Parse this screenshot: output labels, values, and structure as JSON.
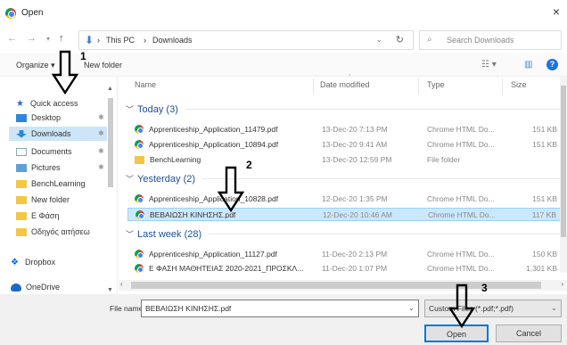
{
  "window": {
    "title": "Open",
    "close_glyph": "×",
    "icon": "chrome-icon"
  },
  "nav": {
    "back": "←",
    "forward": "→",
    "recent": "▾",
    "up": "↑",
    "breadcrumb": [
      "This PC",
      "Downloads"
    ],
    "separator": "›",
    "refresh_glyph": "↻",
    "dropdown_glyph": "⌄",
    "search_placeholder": "Search Downloads"
  },
  "toolbar": {
    "organize": "Organize",
    "new_folder": "New folder",
    "view_glyph": "☷ ▾",
    "pane_glyph": "▥",
    "help_glyph": "?"
  },
  "sidebar": {
    "items": [
      {
        "label": "Quick access",
        "icon": "star-icon",
        "pinned": false
      },
      {
        "label": "Desktop",
        "icon": "desktop-icon",
        "pinned": true
      },
      {
        "label": "Downloads",
        "icon": "downloads-icon",
        "pinned": true,
        "selected": true
      },
      {
        "label": "Documents",
        "icon": "documents-icon",
        "pinned": true
      },
      {
        "label": "Pictures",
        "icon": "pictures-icon",
        "pinned": true
      },
      {
        "label": "BenchLearning",
        "icon": "folder-icon",
        "pinned": false
      },
      {
        "label": "New folder",
        "icon": "folder-icon",
        "pinned": false
      },
      {
        "label": "Ε Φάση",
        "icon": "folder-icon",
        "pinned": false
      },
      {
        "label": "Οδηγός αιτήσεω",
        "icon": "folder-icon",
        "pinned": false
      },
      {
        "label": "Dropbox",
        "icon": "dropbox-icon",
        "pinned": false
      },
      {
        "label": "OneDrive",
        "icon": "onedrive-icon",
        "pinned": false
      }
    ],
    "pin_glyph": "✱"
  },
  "columns": {
    "name": "Name",
    "date": "Date modified",
    "type": "Type",
    "size": "Size"
  },
  "groups": [
    {
      "label": "Today (3)"
    },
    {
      "label": "Yesterday (2)"
    },
    {
      "label": "Last week (28)"
    }
  ],
  "files": [
    {
      "name": "Apprenticeship_Application_11479.pdf",
      "date": "13-Dec-20 7:13 PM",
      "type": "Chrome HTML Do...",
      "size": "151 KB",
      "icon": "chrome"
    },
    {
      "name": "Apprenticeship_Application_10894.pdf",
      "date": "13-Dec-20 9:41 AM",
      "type": "Chrome HTML Do...",
      "size": "151 KB",
      "icon": "chrome"
    },
    {
      "name": "BenchLearning",
      "date": "13-Dec-20 12:59 PM",
      "type": "File folder",
      "size": "",
      "icon": "folder"
    },
    {
      "name": "Apprenticeship_Application_10828.pdf",
      "date": "12-Dec-20 1:35 PM",
      "type": "Chrome HTML Do...",
      "size": "151 KB",
      "icon": "chrome"
    },
    {
      "name": "ΒΕΒΑΙΩΣΗ ΚΙΝΗΣΗΣ.pdf",
      "date": "12-Dec-20 10:46 AM",
      "type": "Chrome HTML Do...",
      "size": "117 KB",
      "icon": "chrome",
      "selected": true
    },
    {
      "name": "Apprenticeship_Application_11127.pdf",
      "date": "11-Dec-20 2:13 PM",
      "type": "Chrome HTML Do...",
      "size": "150 KB",
      "icon": "chrome"
    },
    {
      "name": "Ε ΦΑΣΗ ΜΑΘΗΤΕΙΑΣ 2020-2021_ΠΡΟΣΚΛ...",
      "date": "11-Dec-20 1:07 PM",
      "type": "Chrome HTML Do...",
      "size": "1,301 KB",
      "icon": "chrome"
    }
  ],
  "bottom": {
    "file_name_label": "File name:",
    "file_name_value": "ΒΕΒΑΙΩΣΗ ΚΙΝΗΣΗΣ.pdf",
    "file_type_value": "Custom Files (*.pdf;*.pdf)",
    "open": "Open",
    "cancel": "Cancel",
    "dropdown_glyph": "⌄"
  },
  "annotations": [
    {
      "number": "1",
      "target": "downloads-sidebar-item"
    },
    {
      "number": "2",
      "target": "selected-file"
    },
    {
      "number": "3",
      "target": "open-button"
    }
  ],
  "colors": {
    "selection": "#cce8ff",
    "accent": "#0078d7",
    "group_header": "#1e4f9c"
  }
}
